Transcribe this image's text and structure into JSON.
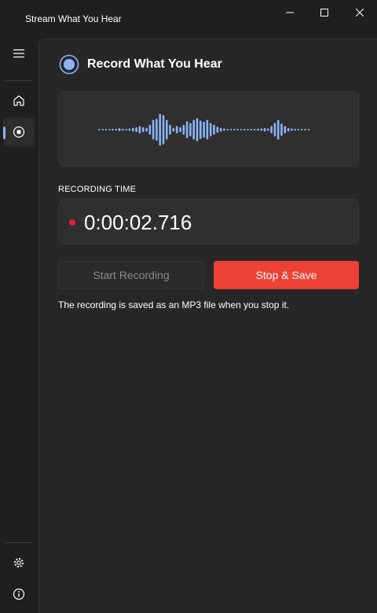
{
  "app": {
    "title": "Stream What You Hear"
  },
  "window_controls": [
    "minimize-icon",
    "maximize-icon",
    "close-icon"
  ],
  "nav": {
    "items": [
      "menu-icon",
      "home-icon",
      "record-icon"
    ],
    "footer_items": [
      "gear-icon",
      "info-icon"
    ],
    "selected": "record-icon"
  },
  "page": {
    "title": "Record What You Hear",
    "recording_time_label": "RECORDING TIME",
    "recording_time": "0:00:02.716",
    "start_button": "Start Recording",
    "start_button_enabled": false,
    "stop_button": "Stop & Save",
    "note": "The recording is saved as an MP3 file when you stop it."
  },
  "waveform": {
    "levels": [
      0.02,
      0.02,
      0.02,
      0.02,
      0.03,
      0.03,
      0.05,
      0.03,
      0.02,
      0.04,
      0.06,
      0.08,
      0.12,
      0.08,
      0.06,
      0.16,
      0.32,
      0.36,
      0.52,
      0.48,
      0.32,
      0.16,
      0.06,
      0.12,
      0.08,
      0.16,
      0.28,
      0.22,
      0.32,
      0.38,
      0.3,
      0.26,
      0.32,
      0.22,
      0.16,
      0.1,
      0.06,
      0.04,
      0.02,
      0.02,
      0.02,
      0.02,
      0.02,
      0.02,
      0.02,
      0.02,
      0.02,
      0.03,
      0.04,
      0.06,
      0.04,
      0.12,
      0.22,
      0.32,
      0.2,
      0.12,
      0.06,
      0.04,
      0.03,
      0.02,
      0.02,
      0.02,
      0.02
    ],
    "color": "#8ab4f8"
  },
  "colors": {
    "accent": "#8ab4f8",
    "recording_dot": "#e5212b",
    "stop_button": "#ee4136",
    "background": "#1f1f1f",
    "pane": "#272727"
  }
}
